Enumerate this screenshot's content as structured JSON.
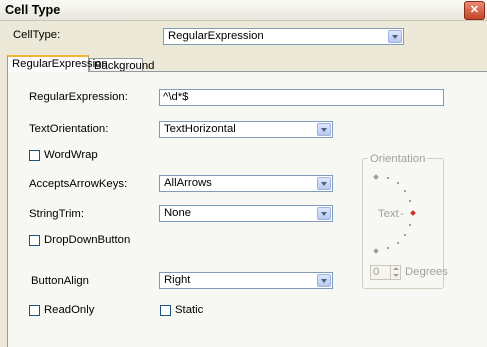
{
  "window": {
    "title": "Cell Type",
    "close_symbol": "✕"
  },
  "celltype": {
    "label": "CellType:",
    "value": "RegularExpression"
  },
  "tabs": [
    {
      "label": "RegularExpression",
      "active": true
    },
    {
      "label": "Background",
      "active": false
    }
  ],
  "form": {
    "regex": {
      "label": "RegularExpression:",
      "value": "^\\d*$"
    },
    "text_orientation": {
      "label": "TextOrientation:",
      "value": "TextHorizontal"
    },
    "wordwrap": {
      "label": "WordWrap",
      "checked": false
    },
    "accepts_arrow_keys": {
      "label": "AcceptsArrowKeys:",
      "value": "AllArrows"
    },
    "string_trim": {
      "label": "StringTrim:",
      "value": "None"
    },
    "dropdown_button": {
      "label": "DropDownButton",
      "checked": false
    },
    "button_align": {
      "label": "ButtonAlign",
      "value": "Right"
    },
    "readonly": {
      "label": "ReadOnly",
      "checked": false
    },
    "static": {
      "label": "Static",
      "checked": false
    }
  },
  "orientation": {
    "title": "Orientation",
    "text_marker": "Text",
    "degrees_value": "0",
    "degrees_label": "Degrees",
    "selected_dot_color": "#d03020"
  }
}
